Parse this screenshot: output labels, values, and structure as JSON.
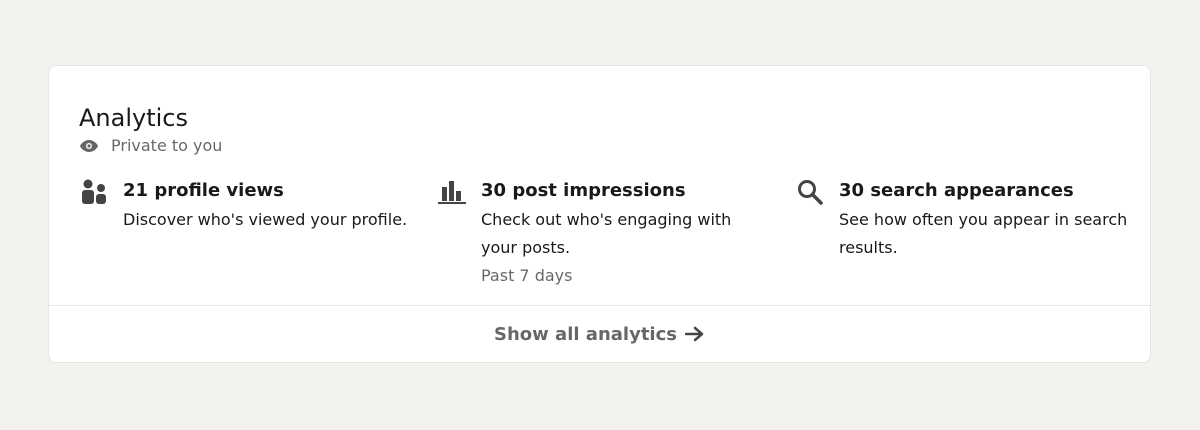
{
  "card": {
    "title": "Analytics",
    "privacy": {
      "icon": "eye-icon",
      "label": "Private to you"
    },
    "items": [
      {
        "icon": "people-icon",
        "title": "21 profile views",
        "description": "Discover who's viewed your profile."
      },
      {
        "icon": "bar-chart-icon",
        "title": "30 post impressions",
        "description": "Check out who's engaging with your posts.",
        "subtext": "Past 7 days"
      },
      {
        "icon": "search-icon",
        "title": "30 search appearances",
        "description": "See how often you appear in search results."
      }
    ],
    "footer": {
      "button_label": "Show all analytics",
      "arrow_icon": "arrow-right-icon"
    }
  },
  "colors": {
    "page_background": "#f3f2ef",
    "card_background": "#ffffff",
    "text_primary": "#191919",
    "text_secondary": "#666666",
    "icon_color": "#444444"
  }
}
